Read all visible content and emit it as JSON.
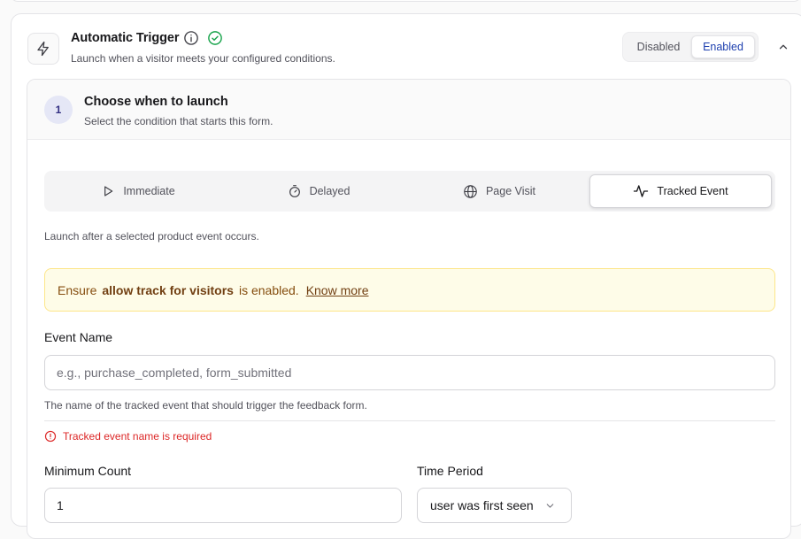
{
  "trigger": {
    "title": "Automatic Trigger",
    "subtitle": "Launch when a visitor meets your configured conditions.",
    "toggle": {
      "disabled_label": "Disabled",
      "enabled_label": "Enabled",
      "selected": "Enabled"
    },
    "icon": "lightning-icon"
  },
  "step": {
    "number": "1",
    "title": "Choose when to launch",
    "subtitle": "Select the condition that starts this form."
  },
  "tabs": [
    {
      "label": "Immediate",
      "icon": "play-icon",
      "active": false
    },
    {
      "label": "Delayed",
      "icon": "timer-icon",
      "active": false
    },
    {
      "label": "Page Visit",
      "icon": "globe-icon",
      "active": false
    },
    {
      "label": "Tracked Event",
      "icon": "activity-icon",
      "active": true
    }
  ],
  "tab_description": "Launch after a selected product event occurs.",
  "notice": {
    "prefix": "Ensure",
    "strong": "allow track for visitors",
    "suffix": "is enabled.",
    "link": "Know more"
  },
  "event_name": {
    "label": "Event Name",
    "placeholder": "e.g., purchase_completed, form_submitted",
    "value": "",
    "help": "The name of the tracked event that should trigger the feedback form.",
    "error": "Tracked event name is required"
  },
  "minimum_count": {
    "label": "Minimum Count",
    "value": "1"
  },
  "time_period": {
    "label": "Time Period",
    "value": "user was first seen"
  },
  "colors": {
    "accent": "#1e40af",
    "success": "#16a34a",
    "error": "#dc2626",
    "notice_bg": "#fefce8"
  }
}
